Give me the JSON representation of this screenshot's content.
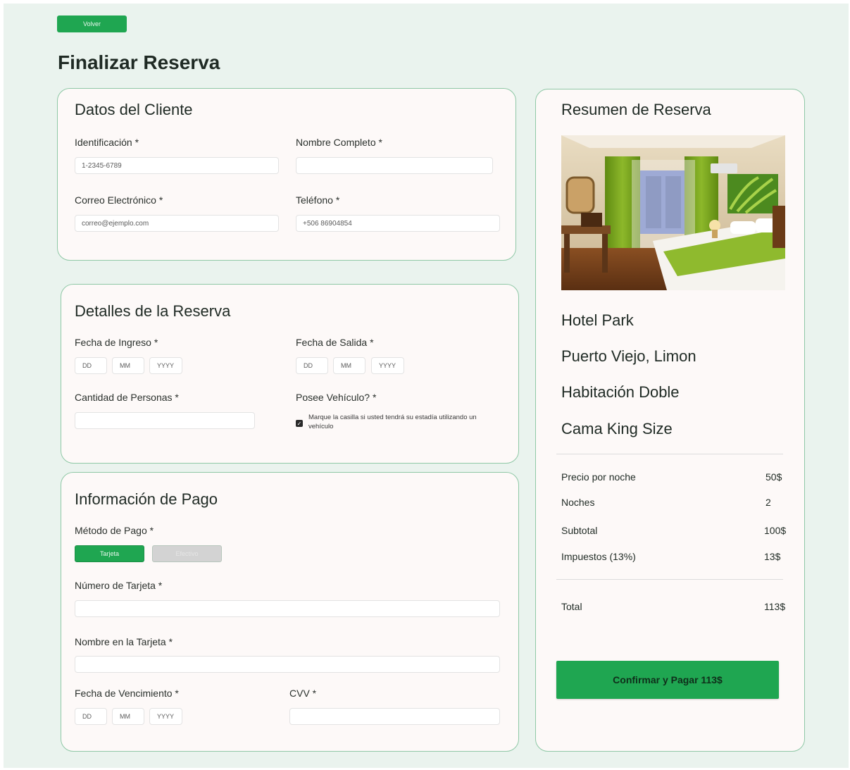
{
  "header": {
    "back_label": "Volver",
    "title": "Finalizar Reserva"
  },
  "cliente": {
    "title": "Datos del Cliente",
    "id_label": "Identificación *",
    "id_placeholder": "1-2345-6789",
    "name_label": "Nombre Completo *",
    "email_label": "Correo Electrónico *",
    "email_placeholder": "correo@ejemplo.com",
    "phone_label": "Teléfono *",
    "phone_placeholder": "+506 86904854"
  },
  "detalles": {
    "title": "Detalles de la Reserva",
    "checkin_label": "Fecha de Ingreso *",
    "checkout_label": "Fecha de Salida *",
    "dd": "DD",
    "mm": "MM",
    "yyyy": "YYYY",
    "people_label": "Cantidad de Personas *",
    "vehicle_label": "Posee Vehículo? *",
    "vehicle_text": "Marque la casilla si usted tendrá su estadía utilizando un vehículo",
    "vehicle_checked": true
  },
  "pago": {
    "title": "Información de Pago",
    "method_label": "Método de Pago *",
    "method_card": "Tarjeta",
    "method_cash": "Efectivo",
    "card_number_label": "Número de Tarjeta *",
    "card_name_label": "Nombre en la Tarjeta *",
    "expiry_label": "Fecha de Vencimiento *",
    "cvv_label": "CVV *"
  },
  "resumen": {
    "title": "Resumen de Reserva",
    "hotel": "Hotel Park",
    "location": "Puerto Viejo, Limon",
    "room": "Habitación Doble",
    "bed": "Cama King Size",
    "rows": [
      {
        "label": "Precio por noche",
        "value": "50$"
      },
      {
        "label": "Noches",
        "value": "2"
      },
      {
        "label": "Subtotal",
        "value": "100$"
      },
      {
        "label": "Impuestos (13%)",
        "value": "13$"
      }
    ],
    "total_label": "Total",
    "total_value": "113$",
    "confirm_label": "Confirmar y Pagar 113$"
  },
  "colors": {
    "accent": "#1fa651",
    "background": "#eaf3ee",
    "card": "#fdf9f8",
    "card_border": "#8fc8a6"
  }
}
